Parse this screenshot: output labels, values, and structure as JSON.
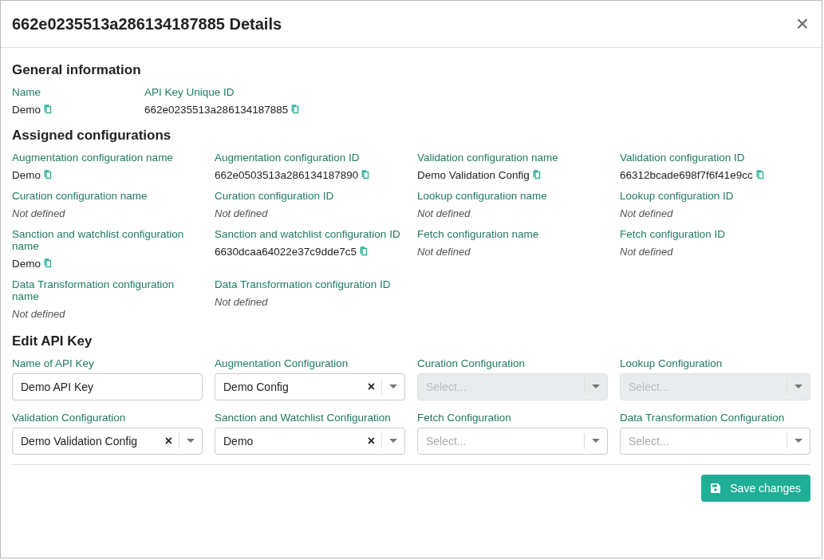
{
  "dialog": {
    "title": "662e0235513a286134187885 Details",
    "close": "×"
  },
  "general": {
    "heading": "General information",
    "fields": [
      {
        "kind": "copyable",
        "label": "Name",
        "value": "Demo"
      },
      {
        "kind": "copyable",
        "label": "API Key Unique ID",
        "value": "662e0235513a286134187885"
      }
    ]
  },
  "assigned": {
    "heading": "Assigned configurations",
    "fields": [
      {
        "kind": "copyable",
        "label": "Augmentation configuration name",
        "value": "Demo"
      },
      {
        "kind": "copyable",
        "label": "Augmentation configuration ID",
        "value": "662e0503513a286134187890"
      },
      {
        "kind": "copyable",
        "label": "Validation configuration name",
        "value": "Demo Validation Config"
      },
      {
        "kind": "copyable",
        "label": "Validation configuration ID",
        "value": "66312bcade698f7f6f41e9cc"
      },
      {
        "kind": "empty",
        "label": "Curation configuration name",
        "value": "Not defined"
      },
      {
        "kind": "empty",
        "label": "Curation configuration ID",
        "value": "Not defined"
      },
      {
        "kind": "empty",
        "label": "Lookup configuration name",
        "value": "Not defined"
      },
      {
        "kind": "empty",
        "label": "Lookup configuration ID",
        "value": "Not defined"
      },
      {
        "kind": "copyable",
        "label": "Sanction and watchlist configuration name",
        "value": "Demo"
      },
      {
        "kind": "copyable",
        "label": "Sanction and watchlist configuration ID",
        "value": "6630dcaa64022e37c9dde7c5"
      },
      {
        "kind": "empty",
        "label": "Fetch configuration name",
        "value": "Not defined"
      },
      {
        "kind": "empty",
        "label": "Fetch configuration ID",
        "value": "Not defined"
      },
      {
        "kind": "empty",
        "label": "Data Transformation configuration name",
        "value": "Not defined"
      },
      {
        "kind": "empty",
        "label": "Data Transformation configuration ID",
        "value": "Not defined"
      }
    ]
  },
  "edit": {
    "heading": "Edit API Key",
    "fields": [
      {
        "kind": "text",
        "label": "Name of API Key",
        "value": "Demo API Key",
        "disabled": false
      },
      {
        "kind": "select",
        "label": "Augmentation Configuration",
        "value": "Demo Config",
        "clear": "×",
        "disabled": false
      },
      {
        "kind": "select",
        "label": "Curation Configuration",
        "placeholder": "Select...",
        "disabled": true
      },
      {
        "kind": "select",
        "label": "Lookup Configuration",
        "placeholder": "Select...",
        "disabled": true
      },
      {
        "kind": "select",
        "label": "Validation Configuration",
        "value": "Demo Validation Config",
        "clear": "×",
        "disabled": false
      },
      {
        "kind": "select",
        "label": "Sanction and Watchlist Configuration",
        "value": "Demo",
        "clear": "×",
        "disabled": false
      },
      {
        "kind": "select",
        "label": "Fetch Configuration",
        "placeholder": "Select...",
        "disabled": false
      },
      {
        "kind": "select",
        "label": "Data Transformation Configuration",
        "placeholder": "Select...",
        "disabled": false
      }
    ]
  },
  "save_button": "Save changes"
}
